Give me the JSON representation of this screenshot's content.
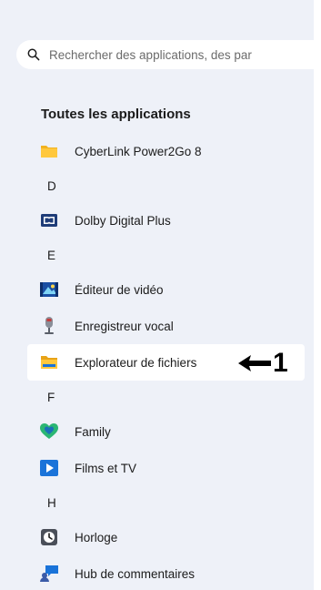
{
  "search": {
    "placeholder": "Rechercher des applications, des par"
  },
  "section": {
    "title": "Toutes les applications"
  },
  "list": [
    {
      "type": "app",
      "label": "CyberLink Power2Go 8",
      "icon": "folder-icon"
    },
    {
      "type": "letter",
      "label": "D"
    },
    {
      "type": "app",
      "label": "Dolby Digital Plus",
      "icon": "dolby-icon"
    },
    {
      "type": "letter",
      "label": "E"
    },
    {
      "type": "app",
      "label": "Éditeur de vidéo",
      "icon": "video-editor-icon"
    },
    {
      "type": "app",
      "label": "Enregistreur vocal",
      "icon": "microphone-icon"
    },
    {
      "type": "app",
      "label": "Explorateur de fichiers",
      "icon": "file-explorer-icon",
      "selected": true
    },
    {
      "type": "letter",
      "label": "F"
    },
    {
      "type": "app",
      "label": "Family",
      "icon": "heart-icon"
    },
    {
      "type": "app",
      "label": "Films et TV",
      "icon": "play-icon"
    },
    {
      "type": "letter",
      "label": "H"
    },
    {
      "type": "app",
      "label": "Horloge",
      "icon": "clock-icon"
    },
    {
      "type": "app",
      "label": "Hub de commentaires",
      "icon": "feedback-icon"
    }
  ],
  "annotation": {
    "label": "1"
  }
}
